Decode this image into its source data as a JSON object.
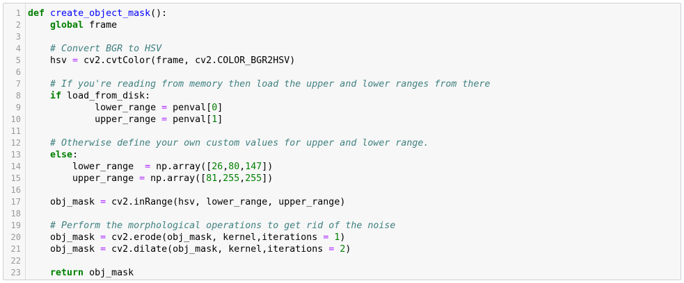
{
  "line_numbers": [
    "1",
    "2",
    "3",
    "4",
    "5",
    "6",
    "7",
    "8",
    "9",
    "10",
    "11",
    "12",
    "13",
    "14",
    "15",
    "16",
    "17",
    "18",
    "19",
    "20",
    "21",
    "22",
    "23"
  ],
  "colors": {
    "keyword": "#008000",
    "function_name": "#0000ff",
    "comment": "#408080",
    "operator": "#aa22ff",
    "number": "#008000",
    "text": "#000000",
    "cell_background": "#f7f7f7",
    "cell_border": "#cfcfcf",
    "line_number": "#999999"
  },
  "code_lines": [
    [
      {
        "t": "kw",
        "v": "def"
      },
      {
        "t": "tx",
        "v": " "
      },
      {
        "t": "fn",
        "v": "create_object_mask"
      },
      {
        "t": "tx",
        "v": "():"
      }
    ],
    [
      {
        "t": "tx",
        "v": "    "
      },
      {
        "t": "kw",
        "v": "global"
      },
      {
        "t": "tx",
        "v": " frame"
      }
    ],
    [],
    [
      {
        "t": "tx",
        "v": "    "
      },
      {
        "t": "cm",
        "v": "# Convert BGR to HSV"
      }
    ],
    [
      {
        "t": "tx",
        "v": "    hsv "
      },
      {
        "t": "op",
        "v": "="
      },
      {
        "t": "tx",
        "v": " cv2.cvtColor(frame, cv2.COLOR_BGR2HSV)"
      }
    ],
    [],
    [
      {
        "t": "tx",
        "v": "    "
      },
      {
        "t": "cm",
        "v": "# If you're reading from memory then load the upper and lower ranges from there"
      }
    ],
    [
      {
        "t": "tx",
        "v": "    "
      },
      {
        "t": "kw",
        "v": "if"
      },
      {
        "t": "tx",
        "v": " load_from_disk:"
      }
    ],
    [
      {
        "t": "tx",
        "v": "            lower_range "
      },
      {
        "t": "op",
        "v": "="
      },
      {
        "t": "tx",
        "v": " penval["
      },
      {
        "t": "nu",
        "v": "0"
      },
      {
        "t": "tx",
        "v": "]"
      }
    ],
    [
      {
        "t": "tx",
        "v": "            upper_range "
      },
      {
        "t": "op",
        "v": "="
      },
      {
        "t": "tx",
        "v": " penval["
      },
      {
        "t": "nu",
        "v": "1"
      },
      {
        "t": "tx",
        "v": "]"
      }
    ],
    [],
    [
      {
        "t": "tx",
        "v": "    "
      },
      {
        "t": "cm",
        "v": "# Otherwise define your own custom values for upper and lower range."
      }
    ],
    [
      {
        "t": "tx",
        "v": "    "
      },
      {
        "t": "kw",
        "v": "else"
      },
      {
        "t": "tx",
        "v": ":"
      }
    ],
    [
      {
        "t": "tx",
        "v": "        lower_range  "
      },
      {
        "t": "op",
        "v": "="
      },
      {
        "t": "tx",
        "v": " np.array(["
      },
      {
        "t": "nu",
        "v": "26"
      },
      {
        "t": "tx",
        "v": ","
      },
      {
        "t": "nu",
        "v": "80"
      },
      {
        "t": "tx",
        "v": ","
      },
      {
        "t": "nu",
        "v": "147"
      },
      {
        "t": "tx",
        "v": "])"
      }
    ],
    [
      {
        "t": "tx",
        "v": "        upper_range "
      },
      {
        "t": "op",
        "v": "="
      },
      {
        "t": "tx",
        "v": " np.array(["
      },
      {
        "t": "nu",
        "v": "81"
      },
      {
        "t": "tx",
        "v": ","
      },
      {
        "t": "nu",
        "v": "255"
      },
      {
        "t": "tx",
        "v": ","
      },
      {
        "t": "nu",
        "v": "255"
      },
      {
        "t": "tx",
        "v": "])"
      }
    ],
    [],
    [
      {
        "t": "tx",
        "v": "    obj_mask "
      },
      {
        "t": "op",
        "v": "="
      },
      {
        "t": "tx",
        "v": " cv2.inRange(hsv, lower_range, upper_range)"
      }
    ],
    [],
    [
      {
        "t": "tx",
        "v": "    "
      },
      {
        "t": "cm",
        "v": "# Perform the morphological operations to get rid of the noise"
      }
    ],
    [
      {
        "t": "tx",
        "v": "    obj_mask "
      },
      {
        "t": "op",
        "v": "="
      },
      {
        "t": "tx",
        "v": " cv2.erode(obj_mask, kernel,iterations "
      },
      {
        "t": "op",
        "v": "="
      },
      {
        "t": "tx",
        "v": " "
      },
      {
        "t": "nu",
        "v": "1"
      },
      {
        "t": "tx",
        "v": ")"
      }
    ],
    [
      {
        "t": "tx",
        "v": "    obj_mask "
      },
      {
        "t": "op",
        "v": "="
      },
      {
        "t": "tx",
        "v": " cv2.dilate(obj_mask, kernel,iterations "
      },
      {
        "t": "op",
        "v": "="
      },
      {
        "t": "tx",
        "v": " "
      },
      {
        "t": "nu",
        "v": "2"
      },
      {
        "t": "tx",
        "v": ")"
      }
    ],
    [],
    [
      {
        "t": "tx",
        "v": "    "
      },
      {
        "t": "kw",
        "v": "return"
      },
      {
        "t": "tx",
        "v": " obj_mask"
      }
    ]
  ]
}
